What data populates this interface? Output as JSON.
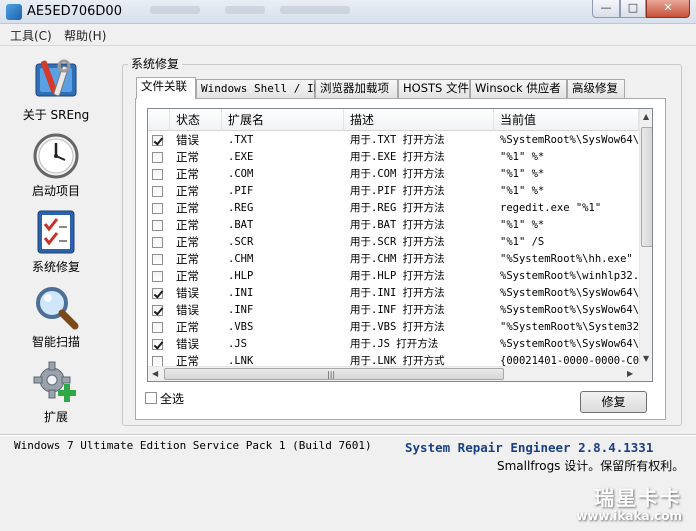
{
  "window": {
    "title": "AE5ED706D00",
    "minimize_glyph": "—",
    "maximize_glyph": "□",
    "close_glyph": "✕"
  },
  "menubar": {
    "items": [
      "工具(C)",
      "帮助(H)"
    ]
  },
  "sidebar": {
    "items": [
      {
        "label": "关于 SREng",
        "icon": "toolbox-icon"
      },
      {
        "label": "启动项目",
        "icon": "clock-icon"
      },
      {
        "label": "系统修复",
        "icon": "checklist-icon"
      },
      {
        "label": "智能扫描",
        "icon": "magnifier-icon"
      },
      {
        "label": "扩展",
        "icon": "gear-plus-icon"
      }
    ]
  },
  "group": {
    "title": "系统修复"
  },
  "tabs": [
    "文件关联",
    "Windows Shell / IE",
    "浏览器加载项",
    "HOSTS 文件",
    "Winsock 供应者",
    "高级修复"
  ],
  "table": {
    "columns": [
      "状态",
      "扩展名",
      "描述",
      "当前值"
    ],
    "rows": [
      {
        "checked": true,
        "status": "错误",
        "ext": ".TXT",
        "desc": "用于.TXT 打开方法",
        "value": "%SystemRoot%\\SysWow64\\"
      },
      {
        "checked": false,
        "status": "正常",
        "ext": ".EXE",
        "desc": "用于.EXE 打开方法",
        "value": "\"%1\" %*"
      },
      {
        "checked": false,
        "status": "正常",
        "ext": ".COM",
        "desc": "用于.COM 打开方法",
        "value": "\"%1\" %*"
      },
      {
        "checked": false,
        "status": "正常",
        "ext": ".PIF",
        "desc": "用于.PIF 打开方法",
        "value": "\"%1\" %*"
      },
      {
        "checked": false,
        "status": "正常",
        "ext": ".REG",
        "desc": "用于.REG 打开方法",
        "value": "regedit.exe \"%1\""
      },
      {
        "checked": false,
        "status": "正常",
        "ext": ".BAT",
        "desc": "用于.BAT 打开方法",
        "value": "\"%1\" %*"
      },
      {
        "checked": false,
        "status": "正常",
        "ext": ".SCR",
        "desc": "用于.SCR 打开方法",
        "value": "\"%1\" /S"
      },
      {
        "checked": false,
        "status": "正常",
        "ext": ".CHM",
        "desc": "用于.CHM 打开方法",
        "value": "\"%SystemRoot%\\hh.exe\" \""
      },
      {
        "checked": false,
        "status": "正常",
        "ext": ".HLP",
        "desc": "用于.HLP 打开方法",
        "value": "%SystemRoot%\\winhlp32."
      },
      {
        "checked": true,
        "status": "错误",
        "ext": ".INI",
        "desc": "用于.INI 打开方法",
        "value": "%SystemRoot%\\SysWow64\\"
      },
      {
        "checked": true,
        "status": "错误",
        "ext": ".INF",
        "desc": "用于.INF 打开方法",
        "value": "%SystemRoot%\\SysWow64\\"
      },
      {
        "checked": false,
        "status": "正常",
        "ext": ".VBS",
        "desc": "用于.VBS 打开方法",
        "value": "\"%SystemRoot%\\System32"
      },
      {
        "checked": true,
        "status": "错误",
        "ext": ".JS",
        "desc": "用于.JS 打开方法",
        "value": "%SystemRoot%\\SysWow64\\"
      },
      {
        "checked": false,
        "status": "正常",
        "ext": ".LNK",
        "desc": "用于.LNK 打开方式",
        "value": "{00021401-0000-0000-C0"
      }
    ]
  },
  "select_all_label": "全选",
  "repair_button_label": "修复",
  "footer": {
    "os_info": "Windows 7 Ultimate Edition Service Pack 1 (Build 7601)",
    "product": "System Repair Engineer 2.8.4.1331",
    "copyright": "Smallfrogs 设计。保留所有权利。"
  },
  "watermark": {
    "brand": "瑞星卡卡",
    "url": "www.ikaka.com"
  }
}
